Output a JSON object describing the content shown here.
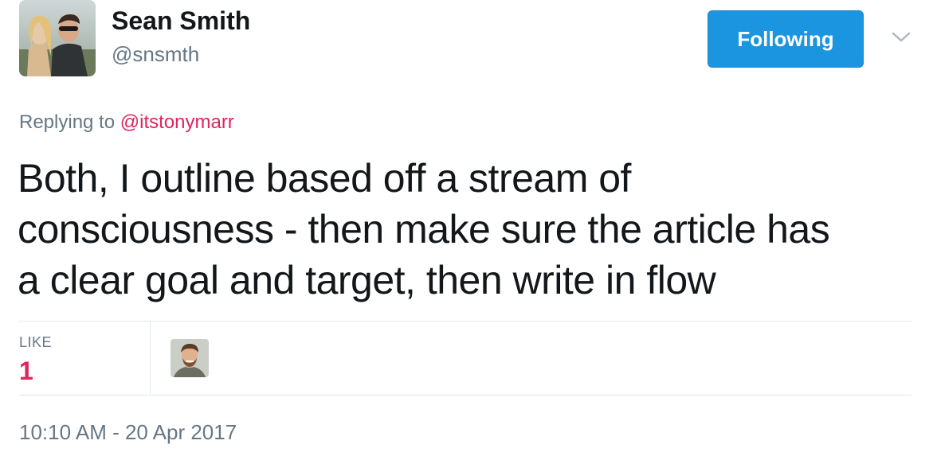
{
  "author": {
    "display_name": "Sean Smith",
    "handle": "@snsmth",
    "avatar_icon": "profile-photo-couple"
  },
  "follow_button": {
    "label": "Following",
    "color": "#1b95e0"
  },
  "menu": {
    "icon": "chevron-down-icon"
  },
  "reply": {
    "prefix": "Replying to",
    "mention": "@itstonymarr"
  },
  "tweet": {
    "lines": [
      "Both, I outline based off a stream of",
      "consciousness - then make sure the article has",
      "a clear goal and target, then write in flow"
    ]
  },
  "stats": {
    "like_label": "LIKE",
    "like_count": "1",
    "liker_icon": "profile-photo-man"
  },
  "timestamp": "10:10 AM - 20 Apr 2017",
  "colors": {
    "accent_pink": "#e0245e",
    "secondary_text": "#657786",
    "primary_text": "#14171a"
  }
}
